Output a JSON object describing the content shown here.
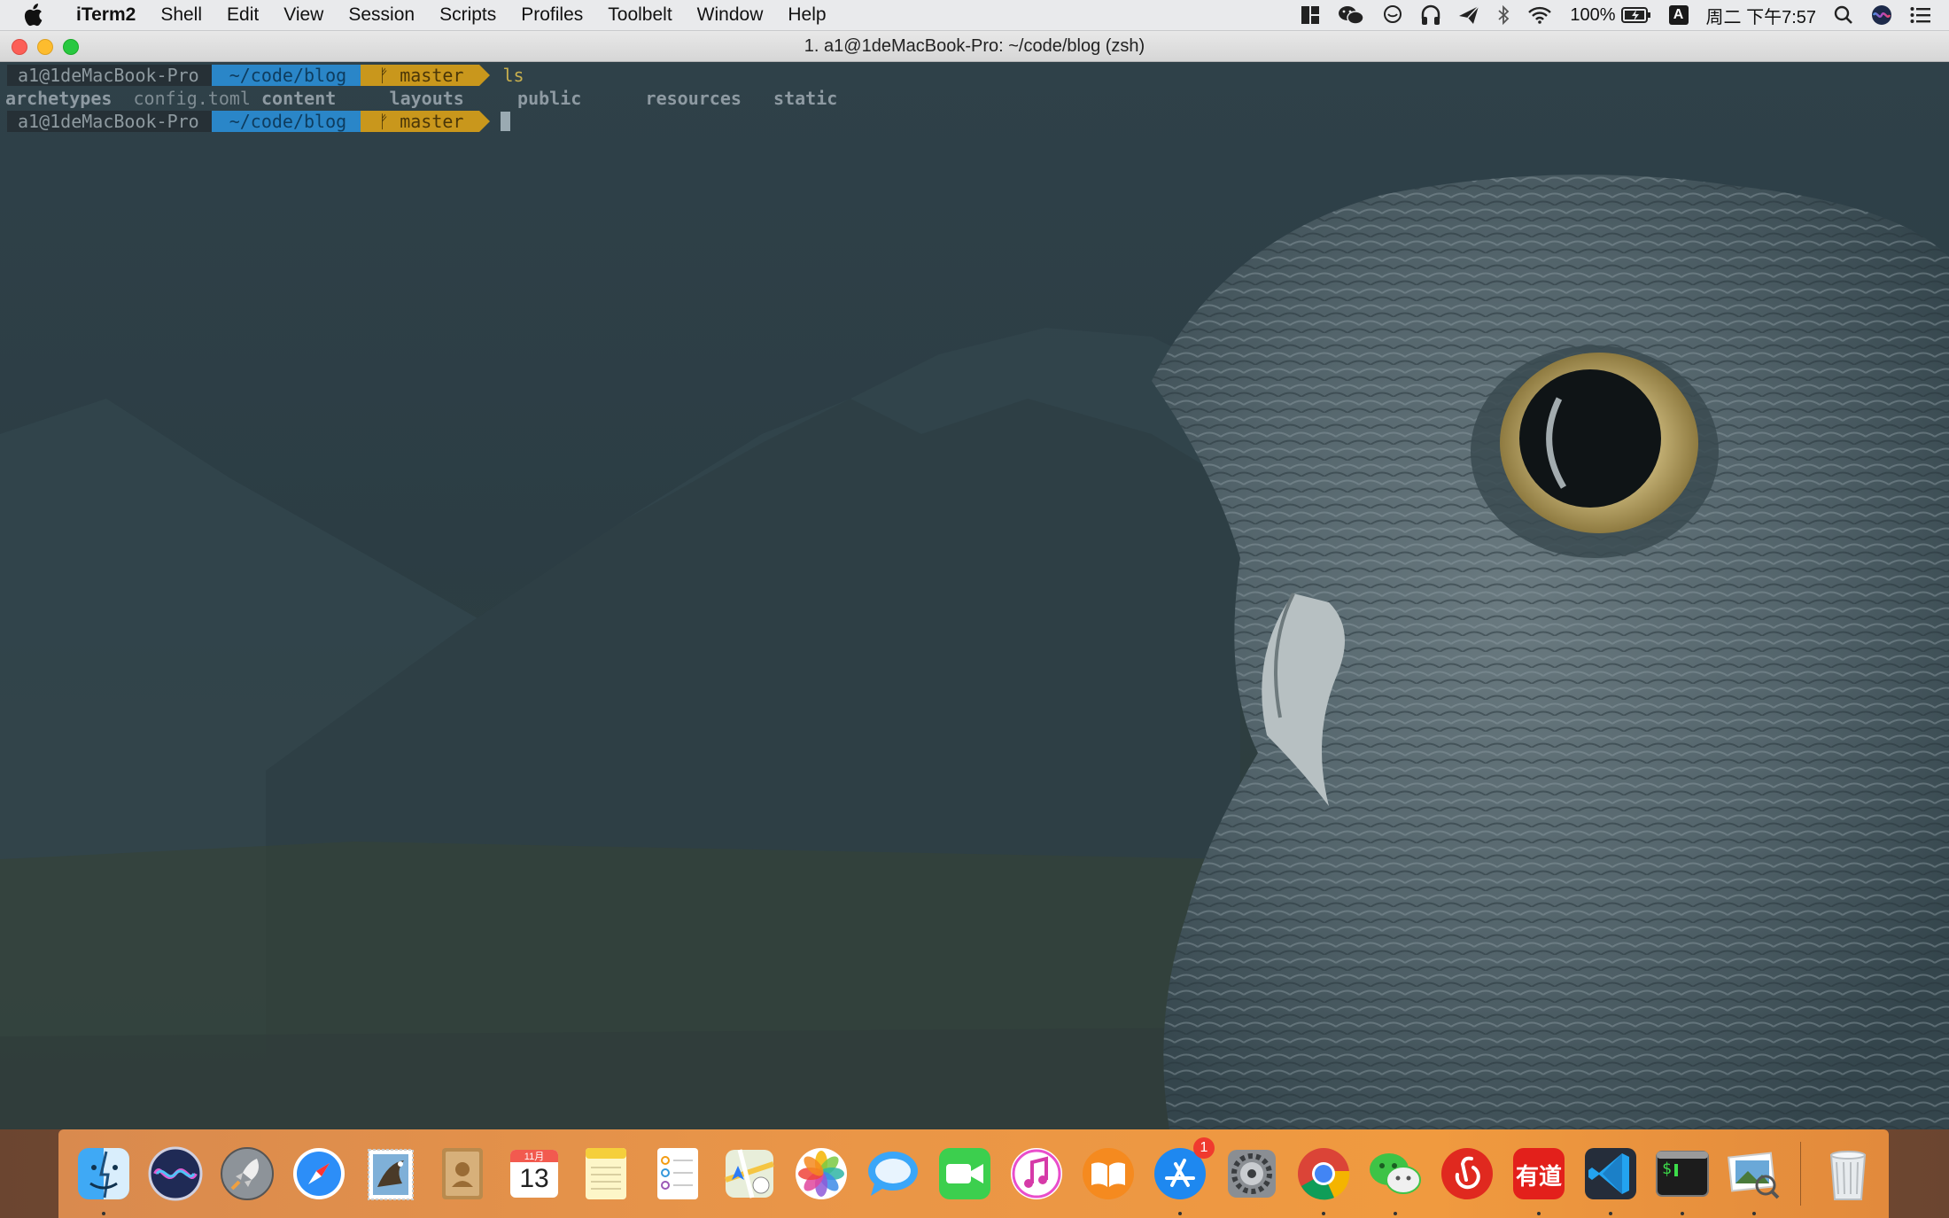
{
  "menubar": {
    "app_name": "iTerm2",
    "menus": [
      "Shell",
      "Edit",
      "View",
      "Session",
      "Scripts",
      "Profiles",
      "Toolbelt",
      "Window",
      "Help"
    ],
    "battery": "100%",
    "ime": "A",
    "clock": "周二 下午7:57",
    "status_icons": [
      "grid-icon",
      "wechat-icon",
      "qq-icon",
      "headphones-icon",
      "paper-plane-icon",
      "bluetooth-icon",
      "wifi-icon",
      "battery-icon",
      "input-method-icon",
      "search-icon",
      "siri-icon",
      "notification-center-icon"
    ]
  },
  "window": {
    "title": "1. a1@1deMacBook-Pro: ~/code/blog (zsh)"
  },
  "terminal": {
    "prompt": {
      "user": "a1@1deMacBook-Pro",
      "path": "~/code/blog",
      "branch": "master",
      "branch_glyph": "ᚠ"
    },
    "command": "ls",
    "ls_output": [
      {
        "name": "archetypes",
        "kind": "dir"
      },
      {
        "name": "config.toml",
        "kind": "file"
      },
      {
        "name": "content",
        "kind": "dir"
      },
      {
        "name": "layouts",
        "kind": "dir"
      },
      {
        "name": "public",
        "kind": "dir"
      },
      {
        "name": "resources",
        "kind": "dir"
      },
      {
        "name": "static",
        "kind": "dir"
      }
    ]
  },
  "dock": {
    "apps": [
      {
        "name": "Finder",
        "icon": "finder-icon",
        "running": true
      },
      {
        "name": "Siri",
        "icon": "siri-icon",
        "running": false
      },
      {
        "name": "Launchpad",
        "icon": "rocket-icon",
        "running": false
      },
      {
        "name": "Safari",
        "icon": "compass-icon",
        "running": false
      },
      {
        "name": "Mail",
        "icon": "stamp-icon",
        "running": false
      },
      {
        "name": "Contacts",
        "icon": "contacts-icon",
        "running": false
      },
      {
        "name": "Calendar",
        "icon": "calendar-icon",
        "running": false,
        "month": "11月",
        "day": "13"
      },
      {
        "name": "Notes",
        "icon": "notes-icon",
        "running": false
      },
      {
        "name": "Reminders",
        "icon": "reminders-icon",
        "running": false
      },
      {
        "name": "Maps",
        "icon": "maps-icon",
        "running": false
      },
      {
        "name": "Photos",
        "icon": "photos-icon",
        "running": false
      },
      {
        "name": "Messages",
        "icon": "messages-icon",
        "running": false
      },
      {
        "name": "FaceTime",
        "icon": "facetime-icon",
        "running": false
      },
      {
        "name": "iTunes",
        "icon": "music-icon",
        "running": false
      },
      {
        "name": "Books",
        "icon": "books-icon",
        "running": false
      },
      {
        "name": "App Store",
        "icon": "appstore-icon",
        "running": true,
        "badge": "1"
      },
      {
        "name": "System Preferences",
        "icon": "gear-icon",
        "running": false
      },
      {
        "name": "Chrome",
        "icon": "chrome-icon",
        "running": true
      },
      {
        "name": "WeChat",
        "icon": "wechat-icon",
        "running": true
      },
      {
        "name": "NetEase Music",
        "icon": "netease-music-icon",
        "running": false
      },
      {
        "name": "Youdao",
        "icon": "youdao-icon",
        "running": true,
        "label": "有道"
      },
      {
        "name": "VS Code",
        "icon": "vscode-icon",
        "running": true
      },
      {
        "name": "iTerm2",
        "icon": "terminal-icon",
        "running": true,
        "label": "$"
      },
      {
        "name": "Preview",
        "icon": "preview-icon",
        "running": true
      },
      {
        "name": "Trash",
        "icon": "trash-icon",
        "running": false
      }
    ]
  },
  "colors": {
    "menubar_bg": "#e9eaec",
    "terminal_bg": "#2d3e45",
    "prompt_user_bg": "#263036",
    "prompt_path_bg": "#2a86c8",
    "prompt_branch_bg": "#c9971c",
    "dock_bg": "#e99548"
  }
}
